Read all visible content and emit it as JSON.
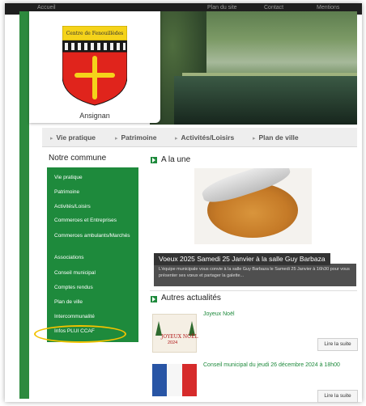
{
  "header": {
    "topbar_items": [
      "Accueil",
      "Plan du site",
      "Contact",
      "Mentions"
    ],
    "town_name": "Ansignan",
    "crest_motto": "Centre de Fenouillèdes"
  },
  "nav": {
    "items": [
      "Vie pratique",
      "Patrimoine",
      "Activités/Loisirs",
      "Plan de ville"
    ]
  },
  "sidebar": {
    "title": "Notre commune",
    "items": [
      "Vie pratique",
      "Patrimoine",
      "Activités/Loisirs",
      "Commerces et Entreprises",
      "Commerces ambulants/Marchés",
      "Associations",
      "Conseil municipal",
      "Comptes rendus",
      "Plan de ville",
      "Intercommunalité",
      "Infos PLUI CCAF"
    ],
    "highlight_color": "#f2c200"
  },
  "a_la_une": {
    "title": "A la une",
    "caption_title": "Voeux 2025 Samedi 25 Janvier à la salle Guy Barbaza",
    "caption_text": "L'équipe municipale vous convie à la salle Guy Barbaza le Samedi 25 Janvier à 16h30 pour vous présenter ses vœux et partager la galette..."
  },
  "autres": {
    "title": "Autres actualités",
    "items": [
      {
        "title": "Joyeux Noël",
        "thumb_line1": "JOYEUX NOËL",
        "thumb_line2": "2024",
        "button": "Lire la suite"
      },
      {
        "title": "Conseil municipal du jeudi 26 décembre 2024 à 18h00",
        "button": "Lire la suite"
      }
    ]
  },
  "colors": {
    "brand_green": "#1e8a3c",
    "crest_red": "#e0241c",
    "crest_yellow": "#f5d31a"
  }
}
